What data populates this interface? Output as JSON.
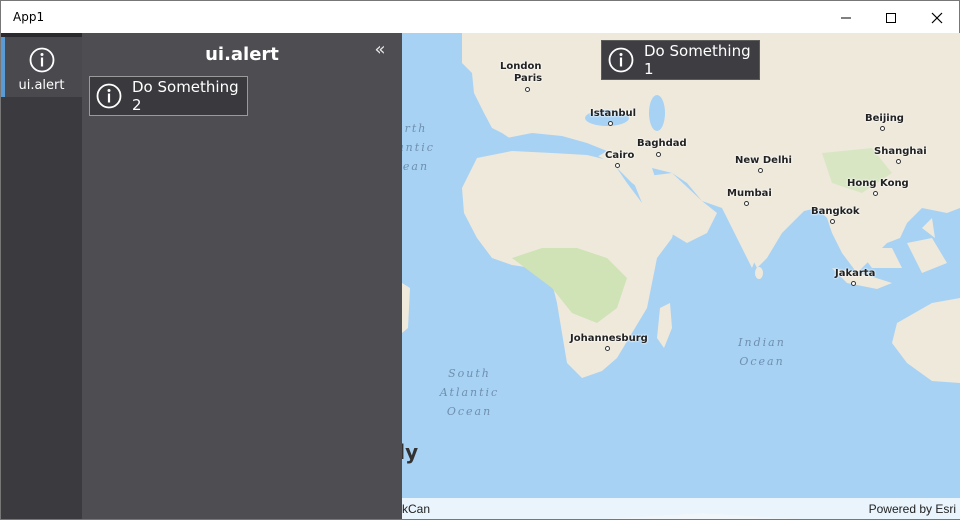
{
  "window": {
    "title": "App1",
    "controls": {
      "minimize": "minimize-icon",
      "maximize": "maximize-icon",
      "close": "close-icon"
    }
  },
  "nav": {
    "items": [
      {
        "label": "ui.alert",
        "icon": "info-icon",
        "selected": true
      }
    ]
  },
  "panel": {
    "title": "ui.alert",
    "collapse_glyph": "«",
    "button_label": "Do Something 2"
  },
  "map": {
    "overlay_button_label": "Do Something 1",
    "cities": [
      "London",
      "Paris",
      "Istanbul",
      "Baghdad",
      "Cairo",
      "New Delhi",
      "Mumbai",
      "Beijing",
      "Shanghai",
      "Hong Kong",
      "Bangkok",
      "Jakarta",
      "Johannesburg"
    ],
    "oceans": {
      "north_atlantic": "rth\nantic\nean",
      "south_atlantic": "South\nAtlantic\nOcean",
      "indian": "Indian\nOcean"
    },
    "partial_text": "nly",
    "attribution_left": "kCan",
    "attribution_right": "Powered by Esri",
    "colors": {
      "water": "#a7d2f4",
      "land": "#efe9dc",
      "vegetation": "#cfe3b6"
    }
  }
}
